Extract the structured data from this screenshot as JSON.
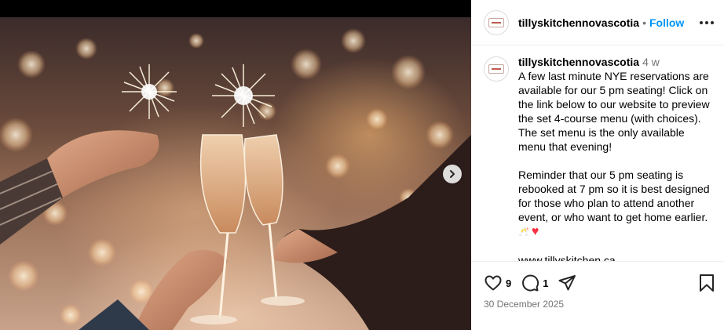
{
  "post": {
    "username": "tillyskitchennovascotia",
    "separator": "•",
    "follow_label": "Follow",
    "caption_time": "4 w",
    "caption_paragraph_1": "A few last minute NYE reservations are available for our 5 pm seating! Click on the link below to our website to preview the set 4-course menu (with choices). The set menu is the only available menu that evening!",
    "caption_paragraph_2": "Reminder that our 5 pm seating is rebooked at 7 pm so it is best designed for those who plan to attend another event, or who want to get home earlier.",
    "caption_emoji_1": "🥂",
    "caption_emoji_2": "♥",
    "caption_link": "www.tillyskitchen.ca",
    "likes_count": "9",
    "comments_count": "1",
    "date": "30 December 2025"
  },
  "icons": {
    "more": "more-options-icon",
    "next": "chevron-right-icon",
    "like": "heart-icon",
    "comment": "comment-icon",
    "share": "share-icon",
    "save": "bookmark-icon"
  },
  "colors": {
    "accent": "#0095f6",
    "heart": "#ff3040",
    "muted": "#737373"
  }
}
